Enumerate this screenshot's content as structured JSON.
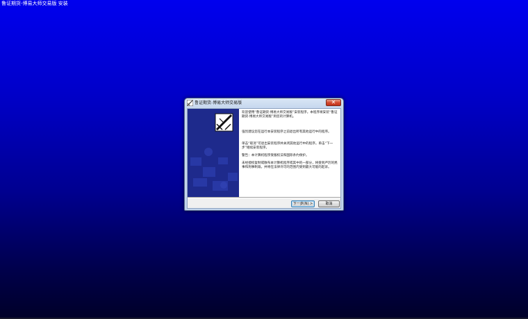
{
  "window": {
    "title": "鲁证期货-博易大师交易版 安装"
  },
  "dialog": {
    "title": "鲁证期货-博易大师交易版",
    "close_label": "✕",
    "paragraphs": [
      "欢迎使用“鲁证期货-博易大师交易版”安装程序。本程序将安装“鲁证期货-博易大师交易版”到您的计算机。",
      "强烈建议您在运行本安装程序之前退出所有其他运行中的程序。",
      "单击“取消”可退出安装程序并关闭其他运行中的程序。单击“下一步”继续安装程序。",
      "警告：本计算机程序受版权法和国际条约保护。",
      "未经授权复制或散布本计算机程序或其中的一部分，将受到严厉的民事和刑事制裁，并将在法律许可的范围内受到最大可能的起诉。"
    ],
    "buttons": {
      "next": "下一步(N) >",
      "cancel": "取消"
    }
  },
  "colors": {
    "desktop_top": "#0000ee",
    "desktop_bottom": "#000028",
    "side_panel": "#1e2a8c"
  }
}
